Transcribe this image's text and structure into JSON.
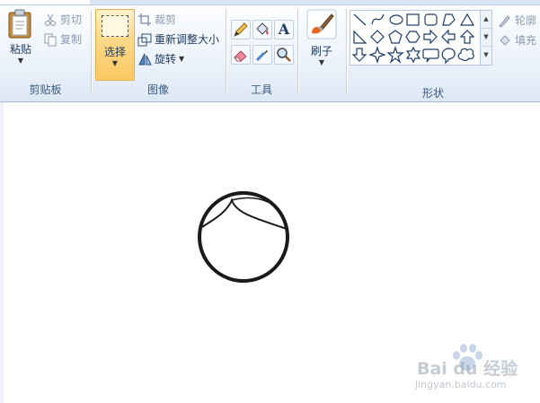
{
  "clipboard": {
    "paste_label": "粘贴",
    "cut_label": "剪切",
    "copy_label": "复制",
    "group_label": "剪贴板"
  },
  "image": {
    "select_label": "选择",
    "crop_label": "裁剪",
    "resize_label": "重新调整大小",
    "rotate_label": "旋转",
    "group_label": "图像"
  },
  "tools": {
    "group_label": "工具",
    "text_tool_glyph": "A"
  },
  "brushes": {
    "label": "刷子"
  },
  "shapes": {
    "outline_label": "轮廓",
    "fill_label": "填充",
    "group_label": "形状"
  },
  "colors": {
    "accent_select": "#fcd98b",
    "ribbon_bg": "#dde8f5",
    "drawing_stroke": "#1a1a1a"
  },
  "watermark": {
    "brand": "Bai du 经验",
    "url": "jingyan.baidu.com"
  }
}
